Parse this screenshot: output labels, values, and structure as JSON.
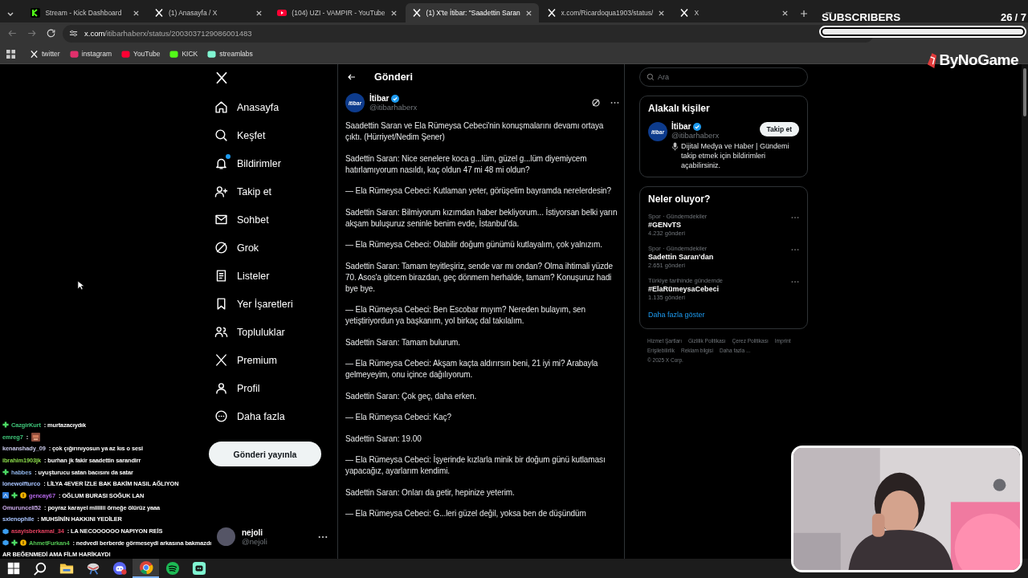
{
  "browser": {
    "tabs": [
      {
        "label": "Stream - Kick Dashboard",
        "kind": "kick",
        "selected": false
      },
      {
        "label": "(1) Anasayfa / X",
        "kind": "x",
        "selected": false
      },
      {
        "label": "(104) UZI - VAMPIR - YouTube",
        "kind": "youtube",
        "selected": false
      },
      {
        "label": "(1) X'te İtibar: \"Saadettin Saran",
        "kind": "x",
        "selected": true
      },
      {
        "label": "x.com/Ricardoqua1903/status/",
        "kind": "x",
        "selected": false
      },
      {
        "label": "X",
        "kind": "x",
        "selected": false
      }
    ],
    "address": {
      "host": "x.com",
      "path": "/itibarhaberx/status/2003037129086001483"
    },
    "bookmarks": [
      {
        "label": "twitter",
        "kind": "x"
      },
      {
        "label": "instagram",
        "kind": "instagram"
      },
      {
        "label": "YouTube",
        "kind": "youtube"
      },
      {
        "label": "KICK",
        "kind": "kick"
      },
      {
        "label": "streamlabs",
        "kind": "streamlabs"
      }
    ]
  },
  "nav": {
    "items": [
      {
        "label": "Anasayfa",
        "kind": "home",
        "badge": false
      },
      {
        "label": "Keşfet",
        "kind": "search",
        "badge": false
      },
      {
        "label": "Bildirimler",
        "kind": "bell",
        "badge": true
      },
      {
        "label": "Takip et",
        "kind": "follow",
        "badge": false
      },
      {
        "label": "Sohbet",
        "kind": "mail",
        "badge": false
      },
      {
        "label": "Grok",
        "kind": "grok",
        "badge": false
      },
      {
        "label": "Listeler",
        "kind": "list",
        "badge": false
      },
      {
        "label": "Yer İşaretleri",
        "kind": "bookmark",
        "badge": false
      },
      {
        "label": "Topluluklar",
        "kind": "people",
        "badge": false
      },
      {
        "label": "Premium",
        "kind": "x",
        "badge": false
      },
      {
        "label": "Profil",
        "kind": "profile",
        "badge": false
      },
      {
        "label": "Daha fazla",
        "kind": "more",
        "badge": false
      }
    ],
    "post_button": "Gönderi yayınla",
    "account": {
      "name": "nejoli",
      "handle": "@nejoli"
    }
  },
  "post": {
    "header": "Gönderi",
    "author": {
      "name": "İtibar",
      "handle": "@itibarhaberx",
      "avatar_text": "itibar",
      "verified": true
    },
    "paragraphs": [
      "Saadettin Saran ve Ela Rümeysa Cebeci'nin konuşmalarını devamı ortaya çıktı. (Hürriyet/Nedim Şener)",
      "Sadettin Saran: Nice senelere koca g...lüm, güzel g...lüm diyemiycem hatırlamıyorum nasıldı, kaç oldun 47 mi 48 mi oldun?",
      "— Ela Rümeysa Cebeci: Kutlaman yeter, görüşelim bayramda nerelerdesin?",
      "Sadettin Saran: Bilmiyorum kızımdan haber bekliyorum... İstiyorsan belki yarın akşam buluşuruz seninle benim evde, İstanbul'da.",
      "— Ela Rümeysa Cebeci: Olabilir doğum günümü kutlayalım, çok yalnızım.",
      "Sadettin Saran: Tamam teyitleşiriz, sende var mı ondan? Olma ihtimali yüzde 70. Asos'a gitcem birazdan, geç dönmem herhalde, tamam? Konuşuruz hadi bye bye.",
      "— Ela Rümeysa Cebeci: Ben Escobar mıyım? Nereden bulayım, sen yetiştiriyordun ya başkanım, yol birkaç dal takılalım.",
      "Sadettin Saran: Tamam bulurum.",
      "— Ela Rümeysa Cebeci: Akşam kaçta aldırırsın beni, 21 iyi mi? Arabayla gelmeyeyim, onu içince dağılıyorum.",
      "Sadettin Saran: Çok geç, daha erken.",
      "— Ela Rümeysa Cebeci: Kaç?",
      "Sadettin Saran: 19.00",
      "— Ela Rümeysa Cebeci: İşyerinde kızlarla minik bir doğum günü kutlaması yapacağız, ayarlarım kendimi.",
      "Sadettin Saran: Onları da getir, hepinize yeterim.",
      "— Ela Rümeysa Cebeci: G...leri güzel değil, yoksa ben de düşündüm"
    ]
  },
  "sidebar": {
    "search": {
      "placeholder": "Ara"
    },
    "people": {
      "title": "Alakalı kişiler",
      "name": "İtibar",
      "handle": "@itibarhaberx",
      "avatar_text": "itibar",
      "verified": true,
      "button": "Takip et",
      "bio": "Dijital Medya ve Haber | Gündemi takip etmek için bildirimleri açabilirsiniz."
    },
    "trends": {
      "title": "Neler oluyor?",
      "items": [
        {
          "context": "Spor · Gündemdekiler",
          "topic": "#GENvTS",
          "count": "4.232 gönderi"
        },
        {
          "context": "Spor · Gündemdekiler",
          "topic": "Sadettin Saran'dan",
          "count": "2.651 gönderi"
        },
        {
          "context": "Türkiye tarihinde gündemde",
          "topic": "#ElaRümeysaCebeci",
          "count": "1.135 gönderi"
        }
      ],
      "more": "Daha fazla göster"
    },
    "footer": {
      "links": [
        "Hizmet Şartları",
        "Gizlilik Politikası",
        "Çerez Politikası",
        "Imprint",
        "Erişilebilirlik",
        "Reklam bilgisi",
        "Daha fazla ..."
      ],
      "copyright": "© 2025 X Corp."
    }
  },
  "overlay": {
    "subscribers": {
      "title": "SUBSCRIBERS",
      "count": "26",
      "goal": "/ 7"
    },
    "logo": "ByNoGame",
    "chat": [
      {
        "kind": "text",
        "user": "CazgirKurt",
        "color": "#3fc77a",
        "badges": [
          {
            "kind": "plus"
          }
        ],
        "text": ": murtazacıydık"
      },
      {
        "kind": "emote",
        "user": "emreg7",
        "color": "#3fc77a",
        "text": ":"
      },
      {
        "kind": "text",
        "user": "kenanshady_09",
        "color": "#c8c8e8",
        "text": ": çok çığırınıyosun ya az kıs o sesi"
      },
      {
        "kind": "text",
        "user": "ibrahim1903jk",
        "color": "#8ad94a",
        "text": ": burhan jk fakir saadettin sarandirr"
      },
      {
        "kind": "text",
        "user": "habbes",
        "color": "#8fb4e8",
        "badges": [
          {
            "kind": "plus"
          }
        ],
        "text": ": uyuşturucu satan bacısını da satar"
      },
      {
        "kind": "text",
        "user": "lonewolfturco",
        "color": "#a8c4ff",
        "text": ": LİLYA 4EVER İZLE BAK BAKİM NASIL AĞLIYON"
      },
      {
        "kind": "text",
        "user": "gencay67",
        "color": "#b266e6",
        "badges": [
          {
            "kind": "sub"
          },
          {
            "kind": "plus"
          },
          {
            "kind": "coin"
          }
        ],
        "text": ": OĞLUM BURASI SOĞUK LAN"
      },
      {
        "kind": "text",
        "user": "Omurunceli52",
        "color": "#c8a8e8",
        "text": ": poyraz karayel miiiiiii örneğe ölürüz yaaa"
      },
      {
        "kind": "text",
        "user": "sxlenophile",
        "color": "#a8c4ff",
        "text": ": MUHSİNİN HAKKINI YEDİLER"
      },
      {
        "kind": "text",
        "user": "asayisberkamal_34",
        "color": "#e0405e",
        "badges": [
          {
            "kind": "cube"
          }
        ],
        "text": ": LA NECOOOOOO NAPIYON REİS"
      },
      {
        "kind": "text",
        "user": "AhmetFurkan4",
        "color": "#52c452",
        "badges": [
          {
            "kind": "cube"
          },
          {
            "kind": "plus"
          },
          {
            "kind": "coin"
          }
        ],
        "text": ": nedvedi berberde görmeseydi arkasına bakmazdı"
      },
      {
        "kind": "continuation",
        "text": "AR BEĞENMEDİ AMA FİLM HARİKAYDI"
      }
    ]
  },
  "taskbar": [
    {
      "kind": "windows",
      "selected": false
    },
    {
      "kind": "search",
      "selected": false
    },
    {
      "kind": "folder",
      "selected": false
    },
    {
      "kind": "tool",
      "selected": false
    },
    {
      "kind": "discord",
      "selected": false
    },
    {
      "kind": "chrome",
      "selected": true
    },
    {
      "kind": "spotify",
      "selected": false
    },
    {
      "kind": "chat",
      "selected": false
    }
  ]
}
